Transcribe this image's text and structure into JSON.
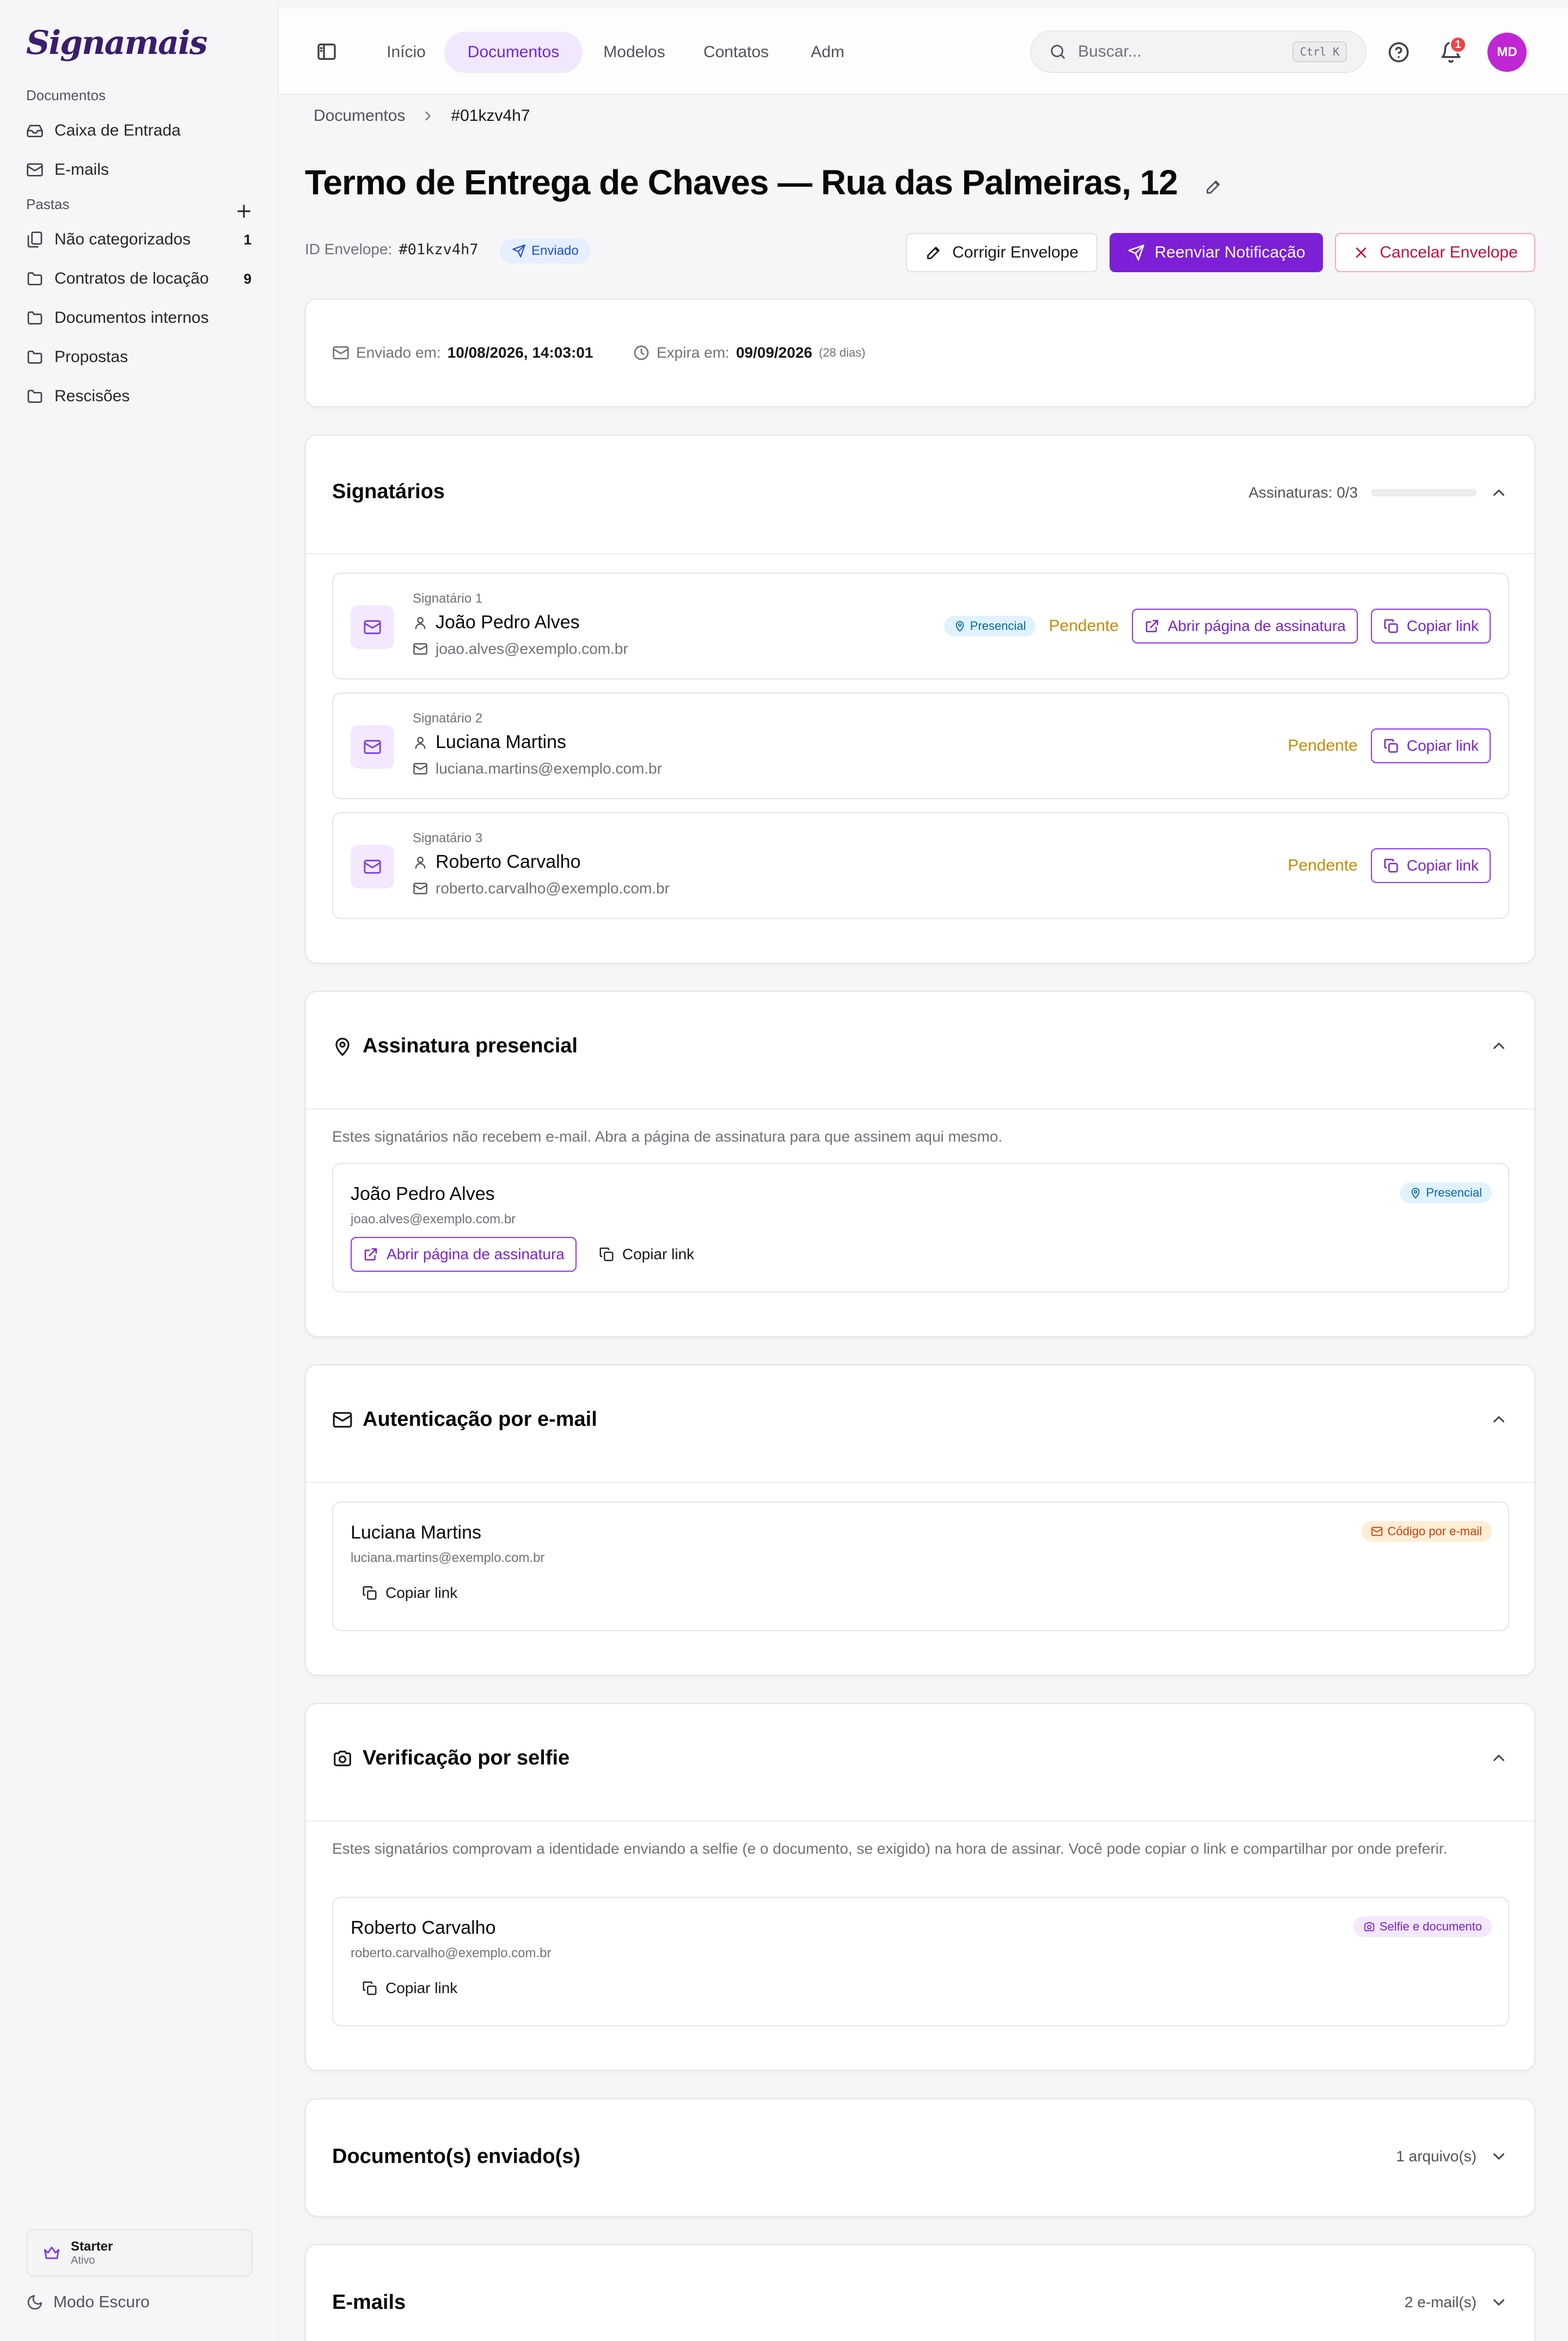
{
  "brand": {
    "logo": "Signamais"
  },
  "sidebar": {
    "documents_group": "Documentos",
    "documents_items": [
      {
        "label": "Caixa de Entrada"
      },
      {
        "label": "E-mails"
      }
    ],
    "folders_group": "Pastas",
    "folders": [
      {
        "label": "Não categorizados",
        "count": "1"
      },
      {
        "label": "Contratos de locação",
        "count": "9"
      },
      {
        "label": "Documentos internos",
        "count": ""
      },
      {
        "label": "Propostas",
        "count": ""
      },
      {
        "label": "Rescisões",
        "count": ""
      }
    ],
    "plan": {
      "name": "Starter",
      "status": "Ativo"
    },
    "dark_mode_label": "Modo Escuro"
  },
  "topnav": {
    "tabs": [
      {
        "label": "Início",
        "active": false
      },
      {
        "label": "Documentos",
        "active": true
      },
      {
        "label": "Modelos",
        "active": false
      },
      {
        "label": "Contatos",
        "active": false
      },
      {
        "label": "Adm",
        "active": false
      }
    ],
    "search_placeholder": "Buscar...",
    "search_shortcut": "Ctrl K",
    "notifications_count": "1",
    "user_initials": "MD"
  },
  "breadcrumb": {
    "parent": "Documentos",
    "current": "#01kzv4h7"
  },
  "envelope": {
    "title": "Termo de Entrega de Chaves — Rua das Palmeiras, 12",
    "id_label": "ID Envelope:",
    "id_value": "#01kzv4h7",
    "status": "Enviado",
    "actions": {
      "correct": "Corrigir Envelope",
      "resend": "Reenviar Notificação",
      "cancel": "Cancelar Envelope"
    },
    "sent_label": "Enviado em:",
    "sent_value": "10/08/2026, 14:03:01",
    "expires_label": "Expira em:",
    "expires_value": "09/09/2026",
    "expires_remaining": "(28 dias)"
  },
  "signers_card": {
    "title": "Signatários",
    "progress_label": "Assinaturas: 0/3",
    "progress_fraction": 0,
    "signers": [
      {
        "label": "Signatário 1",
        "name": "João Pedro Alves",
        "email": "joao.alves@exemplo.com.br",
        "status": "Pendente",
        "badge": "Presencial",
        "open_label": "Abrir página de assinatura",
        "copy_label": "Copiar link"
      },
      {
        "label": "Signatário 2",
        "name": "Luciana Martins",
        "email": "luciana.martins@exemplo.com.br",
        "status": "Pendente",
        "badge": "",
        "open_label": "",
        "copy_label": "Copiar link"
      },
      {
        "label": "Signatário 3",
        "name": "Roberto Carvalho",
        "email": "roberto.carvalho@exemplo.com.br",
        "status": "Pendente",
        "badge": "",
        "open_label": "",
        "copy_label": "Copiar link"
      }
    ]
  },
  "in_person_card": {
    "title": "Assinatura presencial",
    "hint": "Estes signatários não recebem e-mail. Abra a página de assinatura para que assinem aqui mesmo.",
    "item": {
      "name": "João Pedro Alves",
      "email": "joao.alves@exemplo.com.br",
      "badge": "Presencial",
      "open_label": "Abrir página de assinatura",
      "copy_label": "Copiar link"
    }
  },
  "email_auth_card": {
    "title": "Autenticação por e-mail",
    "item": {
      "name": "Luciana Martins",
      "email": "luciana.martins@exemplo.com.br",
      "badge": "Código por e-mail",
      "copy_label": "Copiar link"
    }
  },
  "selfie_card": {
    "title": "Verificação por selfie",
    "hint": "Estes signatários comprovam a identidade enviando a selfie (e o documento, se exigido) na hora de assinar. Você pode copiar o link e compartilhar por onde preferir.",
    "item": {
      "name": "Roberto Carvalho",
      "email": "roberto.carvalho@exemplo.com.br",
      "badge": "Selfie e documento",
      "copy_label": "Copiar link"
    }
  },
  "documents_card": {
    "title": "Documento(s) enviado(s)",
    "summary": "1 arquivo(s)"
  },
  "emails_card": {
    "title": "E-mails",
    "summary": "2 e-mail(s)"
  },
  "colors": {
    "accent": "#7c1fd6",
    "pending": "#ca8a04",
    "danger": "#be123c"
  }
}
